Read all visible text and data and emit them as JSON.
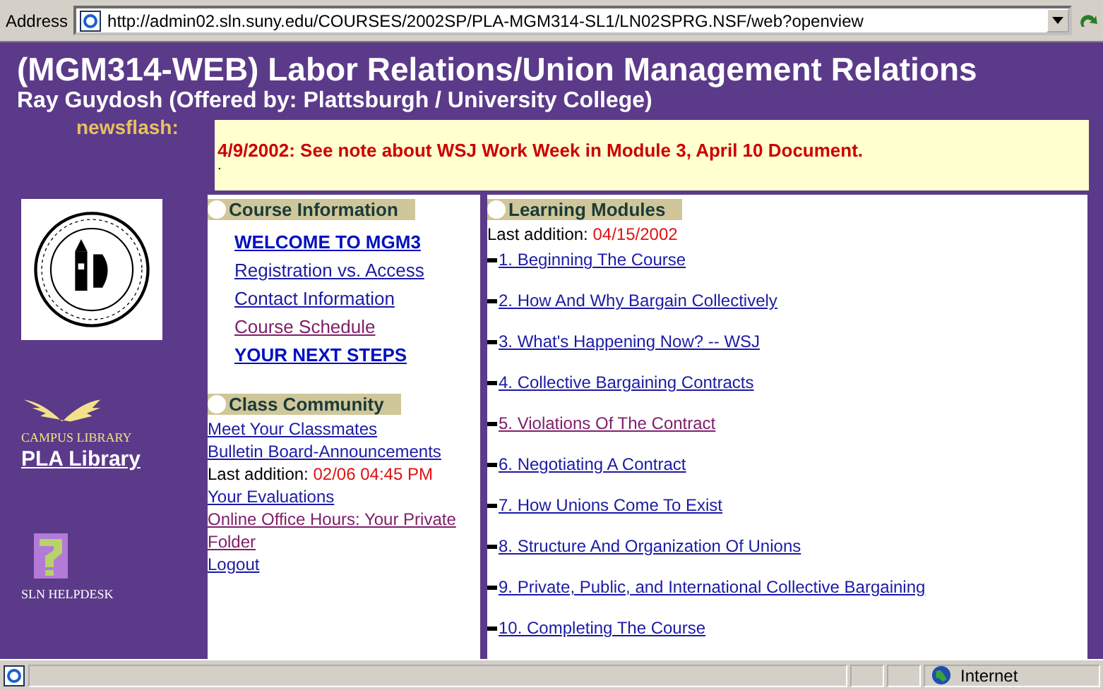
{
  "address_bar": {
    "label": "Address",
    "url": "http://admin02.sln.suny.edu/COURSES/2002SP/PLA-MGM314-SL1/LN02SPRG.NSF/web?openview"
  },
  "header": {
    "title": "(MGM314-WEB) Labor Relations/Union Management Relations",
    "subtitle": "Ray Guydosh (Offered by: Plattsburgh / University College)"
  },
  "newsflash": {
    "label": "newsflash:",
    "message": "4/9/2002: See note about WSJ Work Week in Module 3, April 10 Document.",
    "extra": "."
  },
  "sidebar": {
    "library_caption": "CAMPUS LIBRARY",
    "library_link": "PLA Library",
    "helpdesk_caption": "SLN HELPDESK"
  },
  "course_information": {
    "title": "Course Information",
    "links": [
      {
        "label": "WELCOME TO MGM3",
        "bold": true,
        "visited": false
      },
      {
        "label": "Registration vs. Access",
        "bold": false,
        "visited": false
      },
      {
        "label": "Contact Information",
        "bold": false,
        "visited": false
      },
      {
        "label": "Course Schedule",
        "bold": false,
        "visited": true
      },
      {
        "label": "YOUR NEXT STEPS",
        "bold": true,
        "visited": false
      }
    ]
  },
  "class_community": {
    "title": "Class Community",
    "items": [
      {
        "kind": "link",
        "label": "Meet Your Classmates",
        "visited": false
      },
      {
        "kind": "link",
        "label": "Bulletin Board-Announcements",
        "visited": false
      },
      {
        "kind": "note",
        "label": "Last addition:",
        "value": "02/06 04:45 PM"
      },
      {
        "kind": "link",
        "label": "Your Evaluations",
        "visited": false
      },
      {
        "kind": "link",
        "label": "Online Office Hours: Your Private Folder",
        "visited": true
      },
      {
        "kind": "link",
        "label": "Logout",
        "visited": false
      }
    ]
  },
  "learning_modules": {
    "title": "Learning Modules",
    "last_addition_label": "Last addition:",
    "last_addition": "04/15/2002",
    "modules": [
      {
        "label": "1. Beginning The Course",
        "visited": false
      },
      {
        "label": "2. How And Why Bargain Collectively",
        "visited": false
      },
      {
        "label": "3. What's Happening Now? -- WSJ",
        "visited": false
      },
      {
        "label": "4. Collective Bargaining Contracts",
        "visited": false
      },
      {
        "label": "5. Violations Of The Contract",
        "visited": true
      },
      {
        "label": "6. Negotiating A Contract",
        "visited": false
      },
      {
        "label": "7. How Unions Come To Exist",
        "visited": false
      },
      {
        "label": "8. Structure And Organization Of Unions",
        "visited": false
      },
      {
        "label": "9. Private, Public, and International Collective Bargaining",
        "visited": false
      },
      {
        "label": "10. Completing The Course",
        "visited": false
      }
    ]
  },
  "status_bar": {
    "zone": "Internet"
  }
}
